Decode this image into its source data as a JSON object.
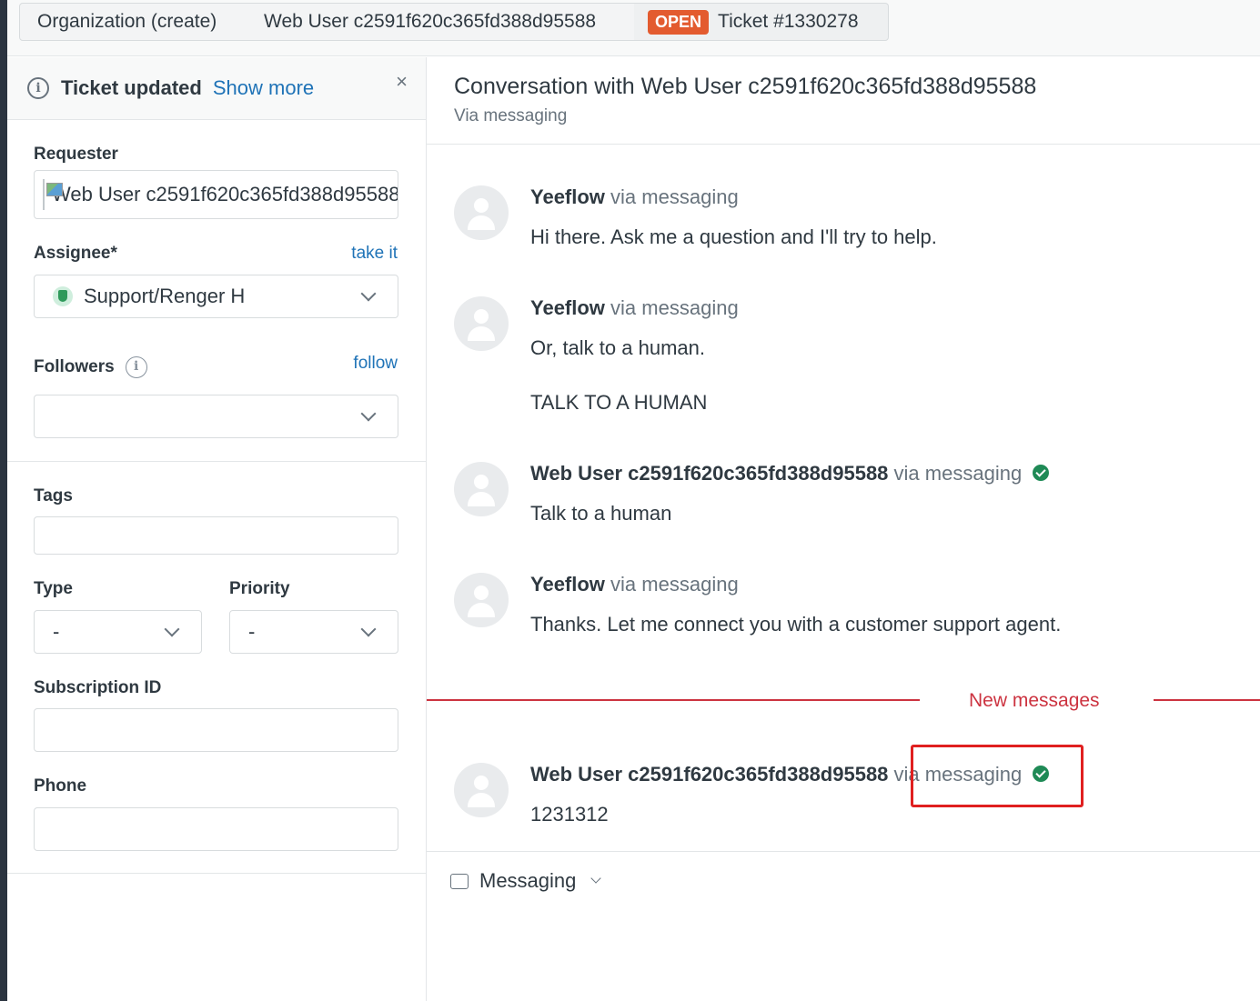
{
  "tabs": {
    "organization": "Organization (create)",
    "user": "Web User c2591f620c365fd388d95588",
    "ticket_status": "OPEN",
    "ticket": "Ticket #1330278"
  },
  "notice": {
    "info_glyph": "i",
    "title": "Ticket updated",
    "link": "Show more",
    "close": "×"
  },
  "fields": {
    "requester_label": "Requester",
    "requester_value": "Web User c2591f620c365fd388d95588",
    "assignee_label": "Assignee*",
    "assignee_action": "take it",
    "assignee_value": "Support/Renger H",
    "followers_label": "Followers",
    "followers_info": "i",
    "followers_action": "follow",
    "followers_value": "",
    "tags_label": "Tags",
    "tags_value": "",
    "type_label": "Type",
    "type_value": "-",
    "priority_label": "Priority",
    "priority_value": "-",
    "subscription_label": "Subscription ID",
    "subscription_value": "",
    "phone_label": "Phone",
    "phone_value": ""
  },
  "conversation": {
    "title": "Conversation with Web User c2591f620c365fd388d95588",
    "subtitle": "Via messaging",
    "messages": [
      {
        "author": "Yeeflow",
        "via": "via messaging",
        "verified": false,
        "body": [
          "Hi there. Ask me a question and I'll try to help."
        ]
      },
      {
        "author": "Yeeflow",
        "via": "via messaging",
        "verified": false,
        "body": [
          "Or, talk to a human.",
          "TALK TO A HUMAN"
        ]
      },
      {
        "author": "Web User c2591f620c365fd388d95588",
        "via": "via messaging",
        "verified": true,
        "body": [
          "Talk to a human"
        ]
      },
      {
        "author": "Yeeflow",
        "via": "via messaging",
        "verified": false,
        "body": [
          "Thanks. Let me connect you with a customer support agent."
        ]
      },
      {
        "author": "Web User c2591f620c365fd388d95588",
        "via": "via messaging",
        "verified": true,
        "body": [
          "1231312"
        ]
      }
    ],
    "new_messages_label": "New messages"
  },
  "composer": {
    "channel": "Messaging"
  },
  "colors": {
    "accent_link": "#1f73b7",
    "open_badge": "#e35b2f",
    "new_messages": "#cc3340",
    "verified": "#1f8a56",
    "highlight": "#e02020"
  }
}
